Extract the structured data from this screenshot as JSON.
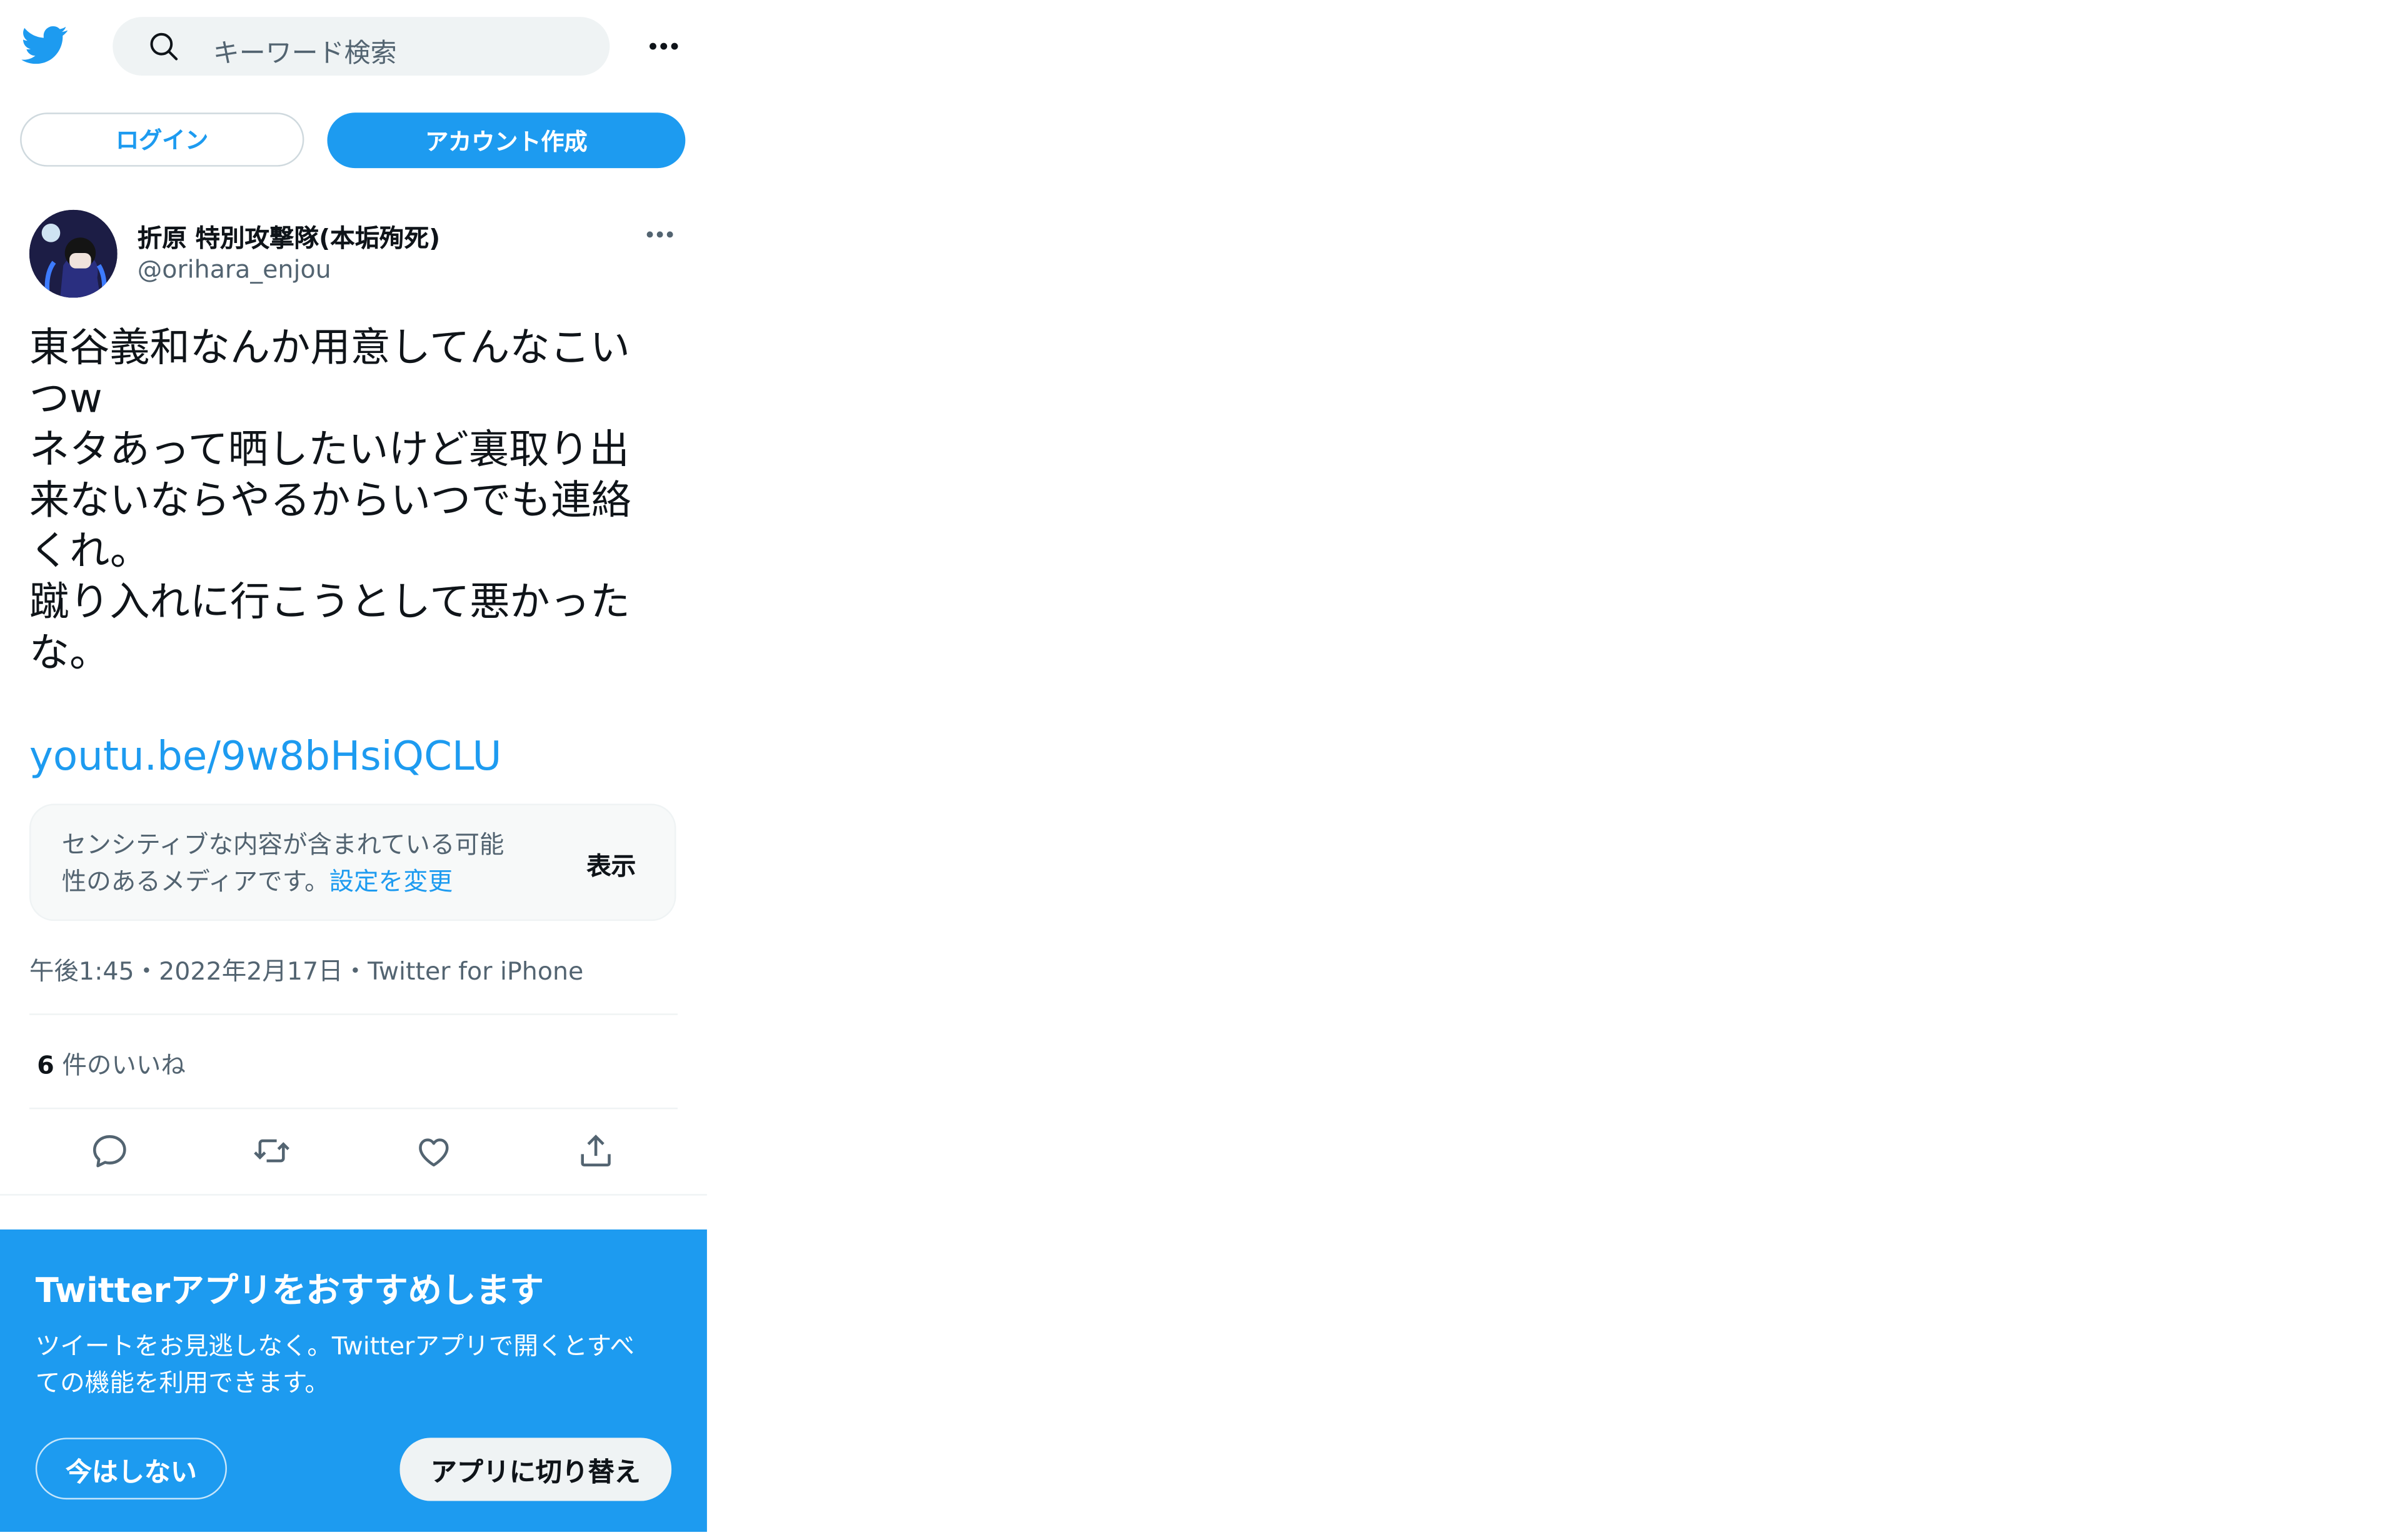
{
  "header": {
    "search_placeholder": "キーワード検索"
  },
  "auth": {
    "login_label": "ログイン",
    "signup_label": "アカウント作成"
  },
  "tweet": {
    "author_name": "折原 特別攻撃隊(本垢殉死)",
    "author_handle": "@orihara_enjou",
    "body_lines": [
      "東谷義和なんか用意してんなこい",
      "つw",
      "ネタあって晒したいけど裏取り出",
      "来ないならやるからいつでも連絡",
      "くれ。",
      "蹴り入れに行こうとして悪かった",
      "な。"
    ],
    "link": "youtu.be/9w8bHsiQCLU",
    "sensitive_notice": {
      "line1": "センシティブな内容が含まれている可能",
      "line2": "性のあるメディアです。",
      "settings_link": "設定を変更",
      "show_label": "表示"
    },
    "meta": "午後1:45・2022年2月17日・Twitter for iPhone",
    "likes_count": "6",
    "likes_label": " 件のいいね"
  },
  "actions": [
    "reply-icon",
    "retweet-icon",
    "like-icon",
    "share-icon"
  ],
  "app_banner": {
    "title": "Twitterアプリをおすすめします",
    "text_line1": "ツイートをお見逃しなく。Twitterアプリで開くとすべ",
    "text_line2": "ての機能を利用できます。",
    "not_now_label": "今はしない",
    "switch_label": "アプリに切り替え"
  },
  "colors": {
    "accent": "#1d9bf0",
    "text_primary": "#0f1419",
    "text_secondary": "#536471",
    "search_bg": "#eff3f4"
  }
}
